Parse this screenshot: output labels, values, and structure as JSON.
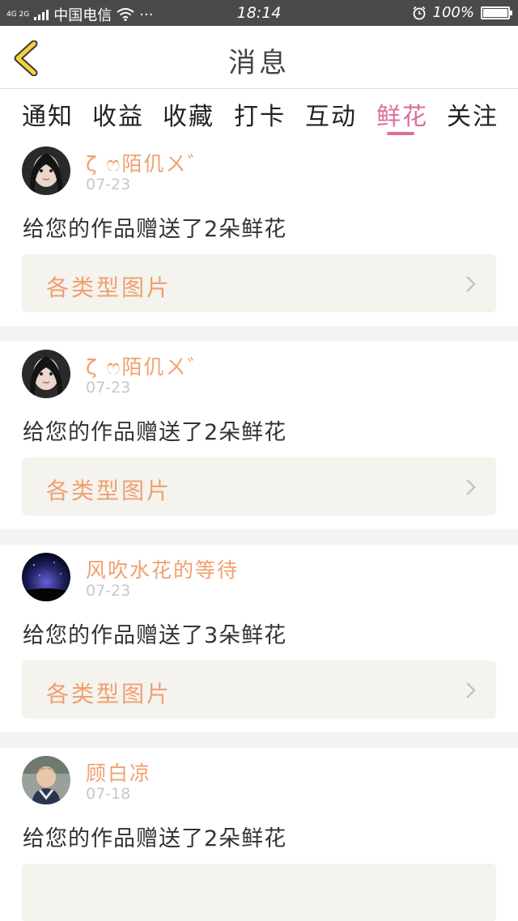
{
  "status_bar": {
    "network": "4G 2G",
    "carrier": "中国电信",
    "more": "···",
    "time": "18:14",
    "battery": "100%",
    "battery_level": 1.0
  },
  "header": {
    "title": "消息"
  },
  "tabs": [
    {
      "label": "通知",
      "active": false
    },
    {
      "label": "收益",
      "active": false
    },
    {
      "label": "收藏",
      "active": false
    },
    {
      "label": "打卡",
      "active": false
    },
    {
      "label": "互动",
      "active": false
    },
    {
      "label": "鲜花",
      "active": true
    },
    {
      "label": "关注",
      "active": false
    }
  ],
  "colors": {
    "accent": "#e06b9e",
    "name_orange": "#f0a070",
    "link_bg": "#f4f3ee"
  },
  "messages": [
    {
      "user": "ζ   ෆ陌仉ㄨ゛",
      "date": "07-23",
      "text": "给您的作品赠送了2朵鲜花",
      "work": "各类型图片",
      "avatar": "avatar-girl-photo"
    },
    {
      "user": "ζ   ෆ陌仉ㄨ゛",
      "date": "07-23",
      "text": "给您的作品赠送了2朵鲜花",
      "work": "各类型图片",
      "avatar": "avatar-girl-photo"
    },
    {
      "user": "风吹水花的等待",
      "date": "07-23",
      "text": "给您的作品赠送了3朵鲜花",
      "work": "各类型图片",
      "avatar": "avatar-night-sky"
    },
    {
      "user": "顾白凉",
      "date": "07-18",
      "text": "给您的作品赠送了2朵鲜花",
      "work": "",
      "avatar": "avatar-child-photo"
    }
  ]
}
